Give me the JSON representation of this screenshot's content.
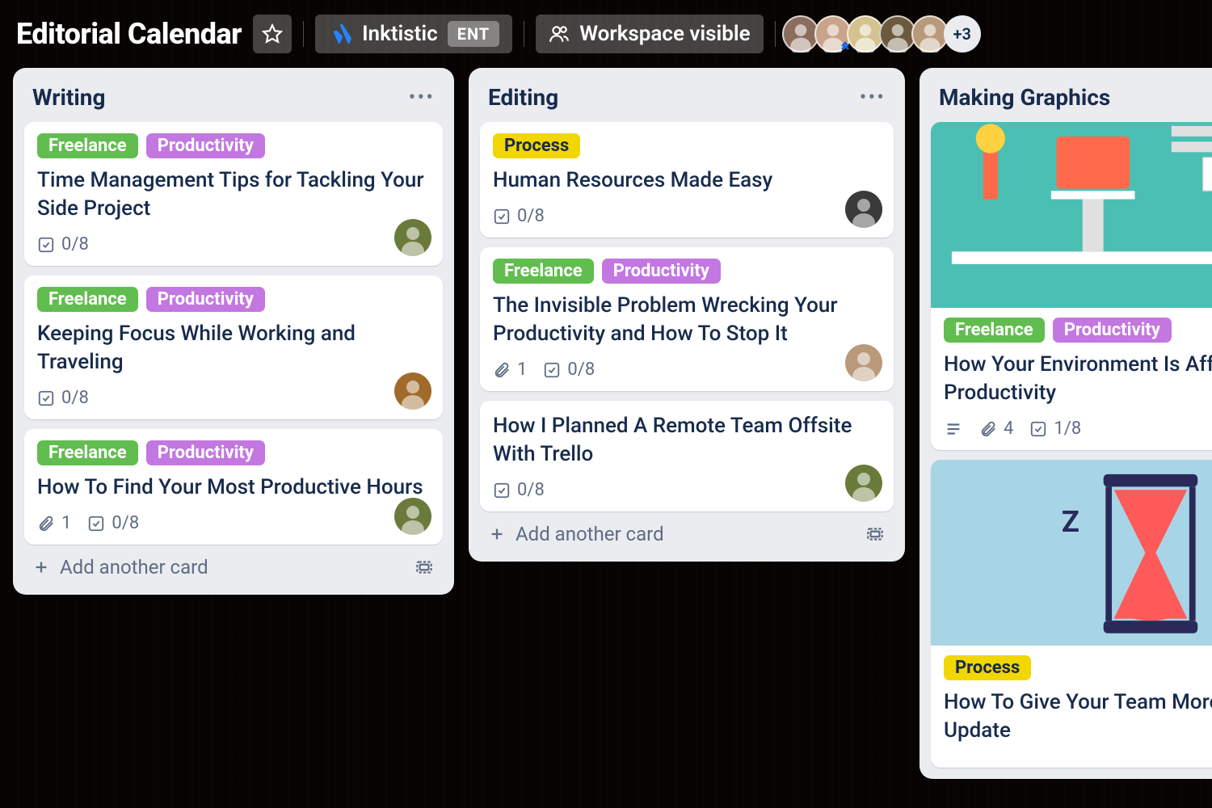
{
  "header": {
    "title": "Editorial Calendar",
    "workspace": "Inktistic",
    "workspace_badge": "ENT",
    "visibility": "Workspace visible",
    "avatar_overflow": "+3",
    "avatars": [
      {
        "bg": "#8a6d5b"
      },
      {
        "bg": "#c9a38a"
      },
      {
        "bg": "#d4c28f"
      },
      {
        "bg": "#6b5a3e"
      },
      {
        "bg": "#b89a7a"
      }
    ]
  },
  "labels": {
    "freelance": "Freelance",
    "productivity": "Productivity",
    "process": "Process"
  },
  "add_card_text": "Add another card",
  "lists": [
    {
      "title": "Writing",
      "cards": [
        {
          "labels": [
            "freelance",
            "productivity"
          ],
          "title": "Time Management Tips for Tackling Your Side Project",
          "checklist": "0/8",
          "avatar_bg": "#6a7a3a"
        },
        {
          "labels": [
            "freelance",
            "productivity"
          ],
          "title": "Keeping Focus While Working and Traveling",
          "checklist": "0/8",
          "avatar_bg": "#a06a2a"
        },
        {
          "labels": [
            "freelance",
            "productivity"
          ],
          "title": "How To Find Your Most Productive Hours",
          "attachments": "1",
          "checklist": "0/8",
          "avatar_bg": "#6a7a3a"
        }
      ]
    },
    {
      "title": "Editing",
      "cards": [
        {
          "labels": [
            "process"
          ],
          "title": "Human Resources Made Easy",
          "checklist": "0/8",
          "avatar_bg": "#3a3a3a"
        },
        {
          "labels": [
            "freelance",
            "productivity"
          ],
          "title": "The Invisible Problem Wrecking Your Productivity and How To Stop It",
          "attachments": "1",
          "checklist": "0/8",
          "avatar_bg": "#b89a7a"
        },
        {
          "labels": [],
          "title": "How I Planned A Remote Team Offsite With Trello",
          "checklist": "0/8",
          "avatar_bg": "#6a7a3a"
        }
      ]
    },
    {
      "title": "Making Graphics",
      "cards": [
        {
          "cover": "meditation",
          "labels": [
            "freelance",
            "productivity"
          ],
          "title": "How Your Environment Is Affecting Your Productivity",
          "description": true,
          "attachments": "4",
          "checklist": "1/8"
        },
        {
          "cover": "hourglass",
          "labels": [
            "process"
          ],
          "title": "How To Give Your Team More Status Update"
        }
      ]
    }
  ]
}
